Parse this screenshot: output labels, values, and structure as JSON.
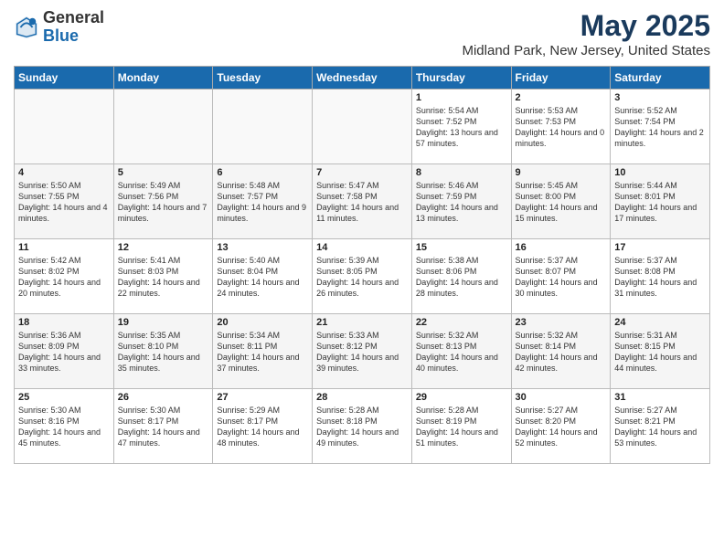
{
  "logo": {
    "general": "General",
    "blue": "Blue"
  },
  "title": "May 2025",
  "subtitle": "Midland Park, New Jersey, United States",
  "days_of_week": [
    "Sunday",
    "Monday",
    "Tuesday",
    "Wednesday",
    "Thursday",
    "Friday",
    "Saturday"
  ],
  "weeks": [
    [
      {
        "day": "",
        "info": ""
      },
      {
        "day": "",
        "info": ""
      },
      {
        "day": "",
        "info": ""
      },
      {
        "day": "",
        "info": ""
      },
      {
        "day": "1",
        "info": "Sunrise: 5:54 AM\nSunset: 7:52 PM\nDaylight: 13 hours\nand 57 minutes."
      },
      {
        "day": "2",
        "info": "Sunrise: 5:53 AM\nSunset: 7:53 PM\nDaylight: 14 hours\nand 0 minutes."
      },
      {
        "day": "3",
        "info": "Sunrise: 5:52 AM\nSunset: 7:54 PM\nDaylight: 14 hours\nand 2 minutes."
      }
    ],
    [
      {
        "day": "4",
        "info": "Sunrise: 5:50 AM\nSunset: 7:55 PM\nDaylight: 14 hours\nand 4 minutes."
      },
      {
        "day": "5",
        "info": "Sunrise: 5:49 AM\nSunset: 7:56 PM\nDaylight: 14 hours\nand 7 minutes."
      },
      {
        "day": "6",
        "info": "Sunrise: 5:48 AM\nSunset: 7:57 PM\nDaylight: 14 hours\nand 9 minutes."
      },
      {
        "day": "7",
        "info": "Sunrise: 5:47 AM\nSunset: 7:58 PM\nDaylight: 14 hours\nand 11 minutes."
      },
      {
        "day": "8",
        "info": "Sunrise: 5:46 AM\nSunset: 7:59 PM\nDaylight: 14 hours\nand 13 minutes."
      },
      {
        "day": "9",
        "info": "Sunrise: 5:45 AM\nSunset: 8:00 PM\nDaylight: 14 hours\nand 15 minutes."
      },
      {
        "day": "10",
        "info": "Sunrise: 5:44 AM\nSunset: 8:01 PM\nDaylight: 14 hours\nand 17 minutes."
      }
    ],
    [
      {
        "day": "11",
        "info": "Sunrise: 5:42 AM\nSunset: 8:02 PM\nDaylight: 14 hours\nand 20 minutes."
      },
      {
        "day": "12",
        "info": "Sunrise: 5:41 AM\nSunset: 8:03 PM\nDaylight: 14 hours\nand 22 minutes."
      },
      {
        "day": "13",
        "info": "Sunrise: 5:40 AM\nSunset: 8:04 PM\nDaylight: 14 hours\nand 24 minutes."
      },
      {
        "day": "14",
        "info": "Sunrise: 5:39 AM\nSunset: 8:05 PM\nDaylight: 14 hours\nand 26 minutes."
      },
      {
        "day": "15",
        "info": "Sunrise: 5:38 AM\nSunset: 8:06 PM\nDaylight: 14 hours\nand 28 minutes."
      },
      {
        "day": "16",
        "info": "Sunrise: 5:37 AM\nSunset: 8:07 PM\nDaylight: 14 hours\nand 30 minutes."
      },
      {
        "day": "17",
        "info": "Sunrise: 5:37 AM\nSunset: 8:08 PM\nDaylight: 14 hours\nand 31 minutes."
      }
    ],
    [
      {
        "day": "18",
        "info": "Sunrise: 5:36 AM\nSunset: 8:09 PM\nDaylight: 14 hours\nand 33 minutes."
      },
      {
        "day": "19",
        "info": "Sunrise: 5:35 AM\nSunset: 8:10 PM\nDaylight: 14 hours\nand 35 minutes."
      },
      {
        "day": "20",
        "info": "Sunrise: 5:34 AM\nSunset: 8:11 PM\nDaylight: 14 hours\nand 37 minutes."
      },
      {
        "day": "21",
        "info": "Sunrise: 5:33 AM\nSunset: 8:12 PM\nDaylight: 14 hours\nand 39 minutes."
      },
      {
        "day": "22",
        "info": "Sunrise: 5:32 AM\nSunset: 8:13 PM\nDaylight: 14 hours\nand 40 minutes."
      },
      {
        "day": "23",
        "info": "Sunrise: 5:32 AM\nSunset: 8:14 PM\nDaylight: 14 hours\nand 42 minutes."
      },
      {
        "day": "24",
        "info": "Sunrise: 5:31 AM\nSunset: 8:15 PM\nDaylight: 14 hours\nand 44 minutes."
      }
    ],
    [
      {
        "day": "25",
        "info": "Sunrise: 5:30 AM\nSunset: 8:16 PM\nDaylight: 14 hours\nand 45 minutes."
      },
      {
        "day": "26",
        "info": "Sunrise: 5:30 AM\nSunset: 8:17 PM\nDaylight: 14 hours\nand 47 minutes."
      },
      {
        "day": "27",
        "info": "Sunrise: 5:29 AM\nSunset: 8:17 PM\nDaylight: 14 hours\nand 48 minutes."
      },
      {
        "day": "28",
        "info": "Sunrise: 5:28 AM\nSunset: 8:18 PM\nDaylight: 14 hours\nand 49 minutes."
      },
      {
        "day": "29",
        "info": "Sunrise: 5:28 AM\nSunset: 8:19 PM\nDaylight: 14 hours\nand 51 minutes."
      },
      {
        "day": "30",
        "info": "Sunrise: 5:27 AM\nSunset: 8:20 PM\nDaylight: 14 hours\nand 52 minutes."
      },
      {
        "day": "31",
        "info": "Sunrise: 5:27 AM\nSunset: 8:21 PM\nDaylight: 14 hours\nand 53 minutes."
      }
    ]
  ]
}
